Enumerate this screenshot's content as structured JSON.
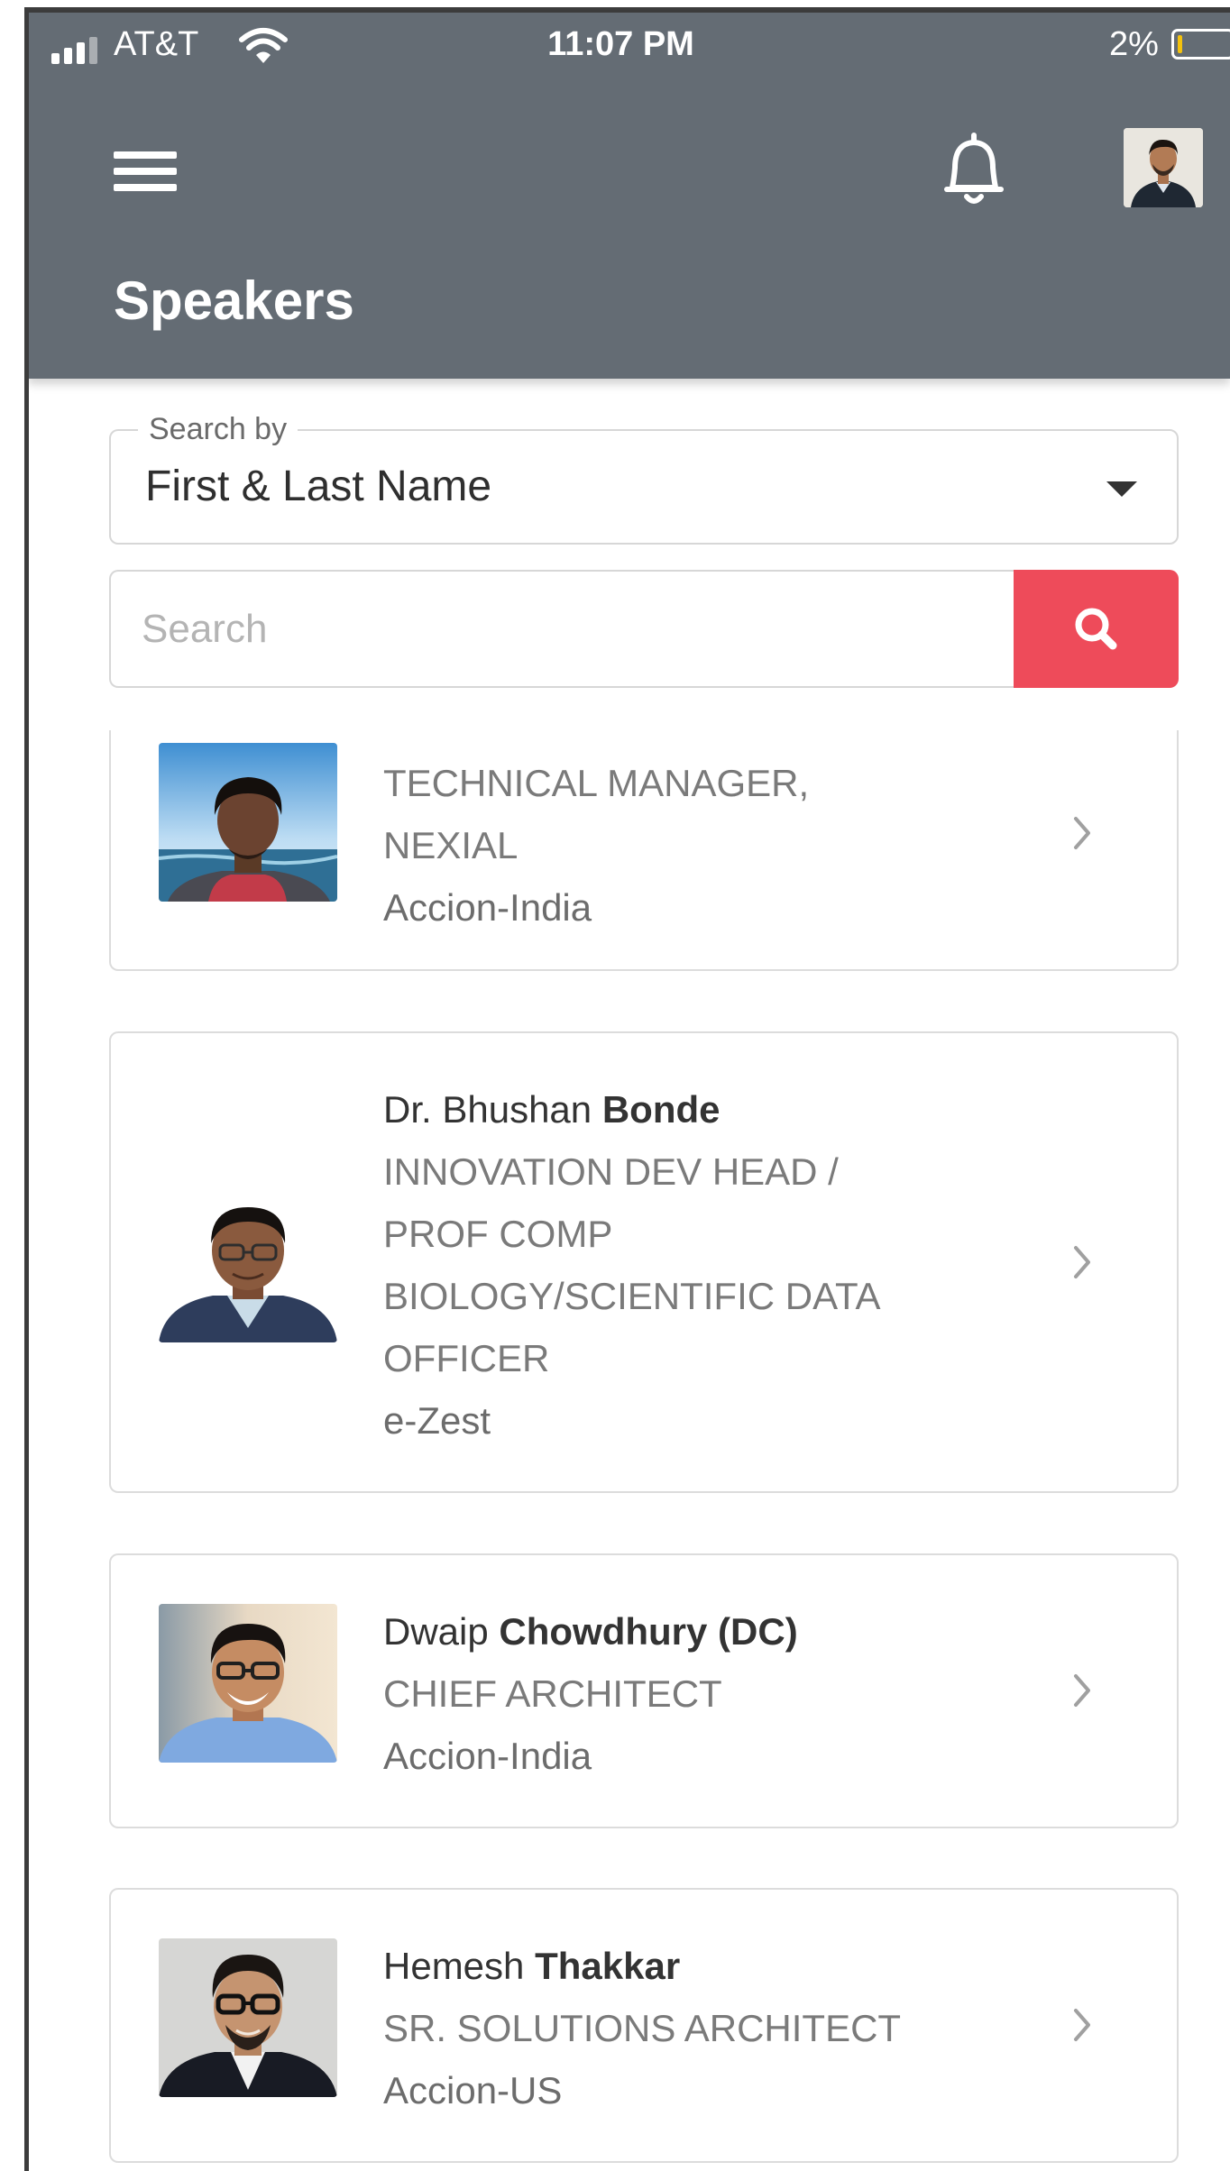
{
  "status_bar": {
    "carrier": "AT&T",
    "time": "11:07 PM",
    "battery_percent": "2%"
  },
  "header": {
    "menu_icon": "hamburger-menu-icon",
    "bell_icon": "bell-icon",
    "title": "Speakers"
  },
  "search": {
    "select_label": "Search by",
    "select_value": "First & Last Name",
    "input_placeholder": "Search",
    "button_icon": "search-icon",
    "button_color": "#ee4b5a"
  },
  "speakers": [
    {
      "first_name": "",
      "last_name": "",
      "title_lines": [
        "TECHNICAL MANAGER,",
        "NEXIAL"
      ],
      "company": "Accion-India"
    },
    {
      "first_name": "Dr. Bhushan",
      "last_name": "Bonde",
      "title_lines": [
        "INNOVATION DEV HEAD /",
        "PROF COMP",
        "BIOLOGY/SCIENTIFIC DATA",
        "OFFICER"
      ],
      "company": "e-Zest"
    },
    {
      "first_name": "Dwaip",
      "last_name": "Chowdhury (DC)",
      "title_lines": [
        "CHIEF ARCHITECT"
      ],
      "company": "Accion-India"
    },
    {
      "first_name": "Hemesh",
      "last_name": "Thakkar",
      "title_lines": [
        "SR. SOLUTIONS ARCHITECT"
      ],
      "company": "Accion-US"
    }
  ],
  "colors": {
    "header_bg": "#646c74",
    "accent": "#ee4b5a"
  }
}
